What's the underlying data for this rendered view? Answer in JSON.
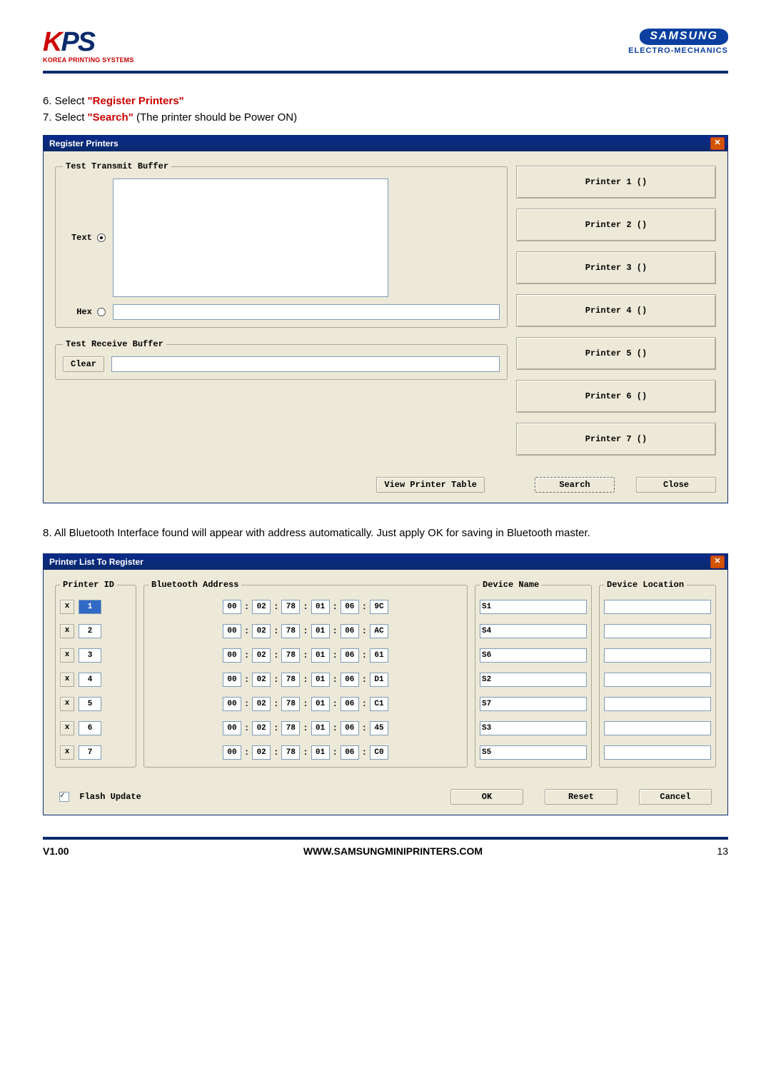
{
  "header": {
    "kps_top": "KOREA PRINTING SYSTEMS",
    "samsung": "SAMSUNG",
    "samsung_sub": "ELECTRO-MECHANICS"
  },
  "instructions": {
    "i6_pre": "6. Select ",
    "i6_hl": "\"Register Printers\"",
    "i7_pre": "7. Select ",
    "i7_hl": "\"Search\"",
    "i7_post": " (The printer should be Power ON)",
    "i8": "8. All Bluetooth Interface found will appear with address automatically. Just apply OK for saving in Bluetooth master."
  },
  "dlg1": {
    "title": "Register Printers",
    "fs_transmit": "Test Transmit Buffer",
    "lbl_text": "Text",
    "lbl_hex": "Hex",
    "lbl_view": "View Printer Table",
    "lbl_search": "Search",
    "lbl_close": "Close",
    "fs_receive": "Test Receive Buffer",
    "lbl_clear": "Clear",
    "printers": [
      "Printer 1 ()",
      "Printer 2 ()",
      "Printer 3 ()",
      "Printer 4 ()",
      "Printer 5 ()",
      "Printer 6 ()",
      "Printer 7 ()"
    ]
  },
  "dlg2": {
    "title": "Printer List To Register",
    "fs_id": "Printer ID",
    "fs_bt": "Bluetooth Address",
    "fs_name": "Device Name",
    "fs_loc": "Device Location",
    "x": "x",
    "rows": [
      {
        "id": "1",
        "sel": true,
        "addr": [
          "00",
          "02",
          "78",
          "01",
          "06",
          "9C"
        ],
        "name": "S1",
        "loc": ""
      },
      {
        "id": "2",
        "sel": false,
        "addr": [
          "00",
          "02",
          "78",
          "01",
          "06",
          "AC"
        ],
        "name": "S4",
        "loc": ""
      },
      {
        "id": "3",
        "sel": false,
        "addr": [
          "00",
          "02",
          "78",
          "01",
          "06",
          "61"
        ],
        "name": "S6",
        "loc": ""
      },
      {
        "id": "4",
        "sel": false,
        "addr": [
          "00",
          "02",
          "78",
          "01",
          "06",
          "D1"
        ],
        "name": "S2",
        "loc": ""
      },
      {
        "id": "5",
        "sel": false,
        "addr": [
          "00",
          "02",
          "78",
          "01",
          "06",
          "C1"
        ],
        "name": "S7",
        "loc": ""
      },
      {
        "id": "6",
        "sel": false,
        "addr": [
          "00",
          "02",
          "78",
          "01",
          "06",
          "45"
        ],
        "name": "S3",
        "loc": ""
      },
      {
        "id": "7",
        "sel": false,
        "addr": [
          "00",
          "02",
          "78",
          "01",
          "06",
          "C0"
        ],
        "name": "S5",
        "loc": ""
      }
    ],
    "flash": "Flash Update",
    "ok": "OK",
    "reset": "Reset",
    "cancel": "Cancel"
  },
  "footer": {
    "version": "V1.00",
    "url": "WWW.SAMSUNGMINIPRINTERS.COM",
    "page": "13"
  }
}
